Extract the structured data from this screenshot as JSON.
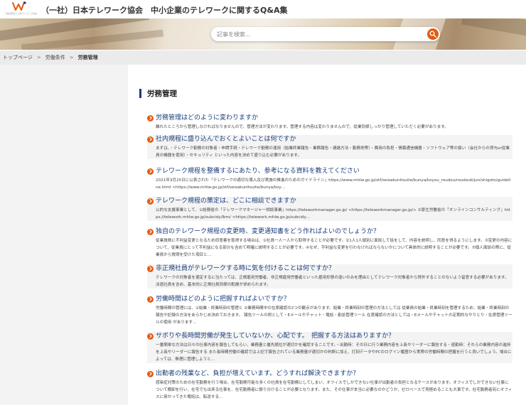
{
  "header": {
    "logo_text": "一般社団法人 日本テレワーク協会",
    "site_title": "（一社）日本テレワーク協会　中小企業のテレワークに関するQ&A集"
  },
  "search": {
    "placeholder": "記事を検索..."
  },
  "breadcrumb": {
    "items": [
      "トップページ",
      "労働条件",
      "労務管理"
    ]
  },
  "page": {
    "heading": "労務管理"
  },
  "faqs": [
    {
      "question": "労務管理はどのように変わりますか",
      "answer": "離れたところから管理しなければなりませんので、管理方法が変わります。管理する内容は変わりませんので、従業同様しっかり管理していただく必要があります。"
    },
    {
      "question": "社内規程に盛り込んでおくとよいことは何ですか",
      "answer": "まずは、・テレワーク勤務の対象者・申請手続・テレワーク勤務の運用（始業終業報告・業務報告・連絡方法・勤務地等）・費用の負担・情報通信機器・ソフトウェア等の扱い（会社からの貸与or従業員の機器を使用）・セキュリティ といった内容を決めて盛り込む必要があります。"
    },
    {
      "question": "テレワーク規程を整備するにあたり、参考になる資料を教えてください",
      "answer": "2021年3月25日に公表された「テレワークの適切な導入及び実施の推進のためのガイドライン」https://www.mhlw.go.jp/stf/seisakunitsuite/bunya/koyou_roudou/roudoukijun/shigoto/guideline.html <https://www.mhlw.go.jp/stf/seisakunitsuite/bunya/koy…"
    },
    {
      "question": "テレワーク規程の策定は、どこに相談できますか",
      "answer": "公的な支援事業として、①総務省の「テレワークマネージャー相談事業」https://teleworkmanager.go.jp/ <https://teleworkmanager.go.jp/> ②厚生労働省の「オンラインコンサルティング」https://telework.mhlw.go.jp/subcidy/lbm/ <https://telework.mhlw.go.jp/subcidy…"
    },
    {
      "question": "独自のテレワーク規程の変更時、変更通知書をどう作ればよいのでしょうか？",
      "answer": "従業員側に不利益変更となるため同意書を取得する場合は、①社員一人一人から取得することが必要です。②1人1人個別に面談して話をして、内容を説明し、同意を得るようにします。③変更の内容について、従業員にとって不利益になる部分も含めて明確に説明することが必要です。④なぜ、不利益な変更を行わなければならないかについて具体的に説明することが必要です。⑤個人面談の際に、従業員から質問を受けた項目と…"
    },
    {
      "question": "非正規社員がテレワークする時に気を付けることは何ですか？",
      "answer": "テレワークの対象者を選定するに当たっては、正規雇用労働者、非正規雇用労働者といった雇用形態の違いのみを理由としてテレワーク対象者から除外することのないよう留意する必要があります。派遣社員を含め、基本的に正規社員同様の配慮が求められます。"
    },
    {
      "question": "労働時間はどのように把握すればよいですか？",
      "answer": "労働時間の管理には、①始業・終業時刻の管理と ②業務時間中の在席確認の2つの観点があります。始業・終業時刻の管理の方法としては 従業員の始業・終業時刻を管理するため、始業・終業時刻の報告や記録の方法をあらかじめ決めておきます。 報告ツールの例として・Eメールやチャット・電話・勤怠管理ツール 在席確認の方法としては・Eメールやチャットの定期的なやりとり・在席管理ツールの使用 があります…"
    },
    {
      "question": "サボりや長時間労働が発生していないか、心配です。　把握する方法はありますか？",
      "answer": "一番簡単な方法は日々の仕事内容を報告してもらい、業務量と優先順位が適切かを確認することです。・出勤時：その日に行う業務内容を上長やリーダーに報告する・退勤時：それらの業務内容の進捗を上長やリーダーに報告する また長時間労働の確認では上記で報告されている業務量が適切かの判断に加え、打刻データやPCのログイン履歴から実際の労働時間の把握を行うと良いでしょう。場合によっては、無理に管理しようと…"
    },
    {
      "question": "出勤者の残業など、負担が増えています。どうすれば解決できますか？",
      "answer": "感染症対策のための在宅勤務を行う場合、在宅勤務可能な多くの社員を在宅勤務にしてしまい、オフィスでしかできない仕事が出勤者の負担となるケースがあります。オフィスでしかできない仕事について棚卸を行い、在宅でも出来る仕事を、在宅勤務者に振り分けることが必要となります。また、その仕事が本当に必要なのかどうか、ゼロベースで見極めることも大事です。在宅勤務者宛にオフィスに掛かってきた電話は、転送する…"
    }
  ]
}
